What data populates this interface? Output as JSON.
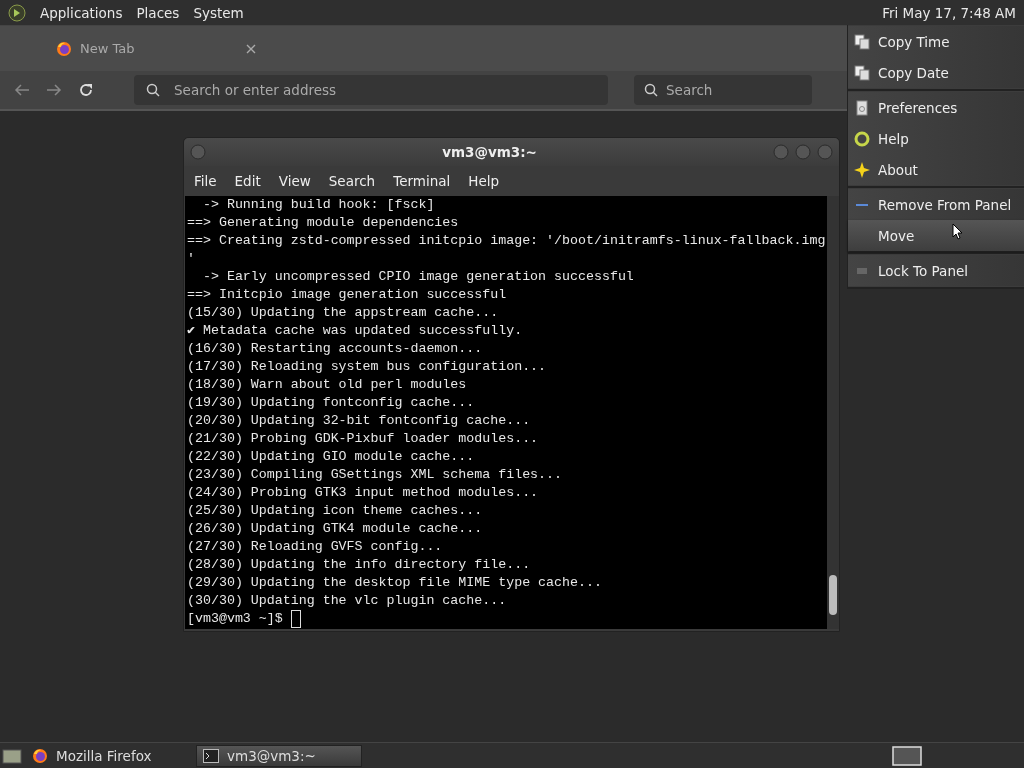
{
  "top_panel": {
    "menus": [
      "Applications",
      "Places",
      "System"
    ],
    "clock": "Fri May 17,  7:48 AM"
  },
  "browser": {
    "tab": {
      "title": "New Tab"
    },
    "address": {
      "placeholder": "Search or enter address"
    },
    "search": {
      "placeholder": "Search"
    }
  },
  "terminal": {
    "title": "vm3@vm3:~",
    "menu": [
      "File",
      "Edit",
      "View",
      "Search",
      "Terminal",
      "Help"
    ],
    "lines": [
      "  -> Running build hook: [fsck]",
      "==> Generating module dependencies",
      "==> Creating zstd-compressed initcpio image: '/boot/initramfs-linux-fallback.img",
      "'",
      "  -> Early uncompressed CPIO image generation successful",
      "==> Initcpio image generation successful",
      "(15/30) Updating the appstream cache...",
      "✔ Metadata cache was updated successfully.",
      "(16/30) Restarting accounts-daemon...",
      "(17/30) Reloading system bus configuration...",
      "(18/30) Warn about old perl modules",
      "(19/30) Updating fontconfig cache...",
      "(20/30) Updating 32-bit fontconfig cache...",
      "(21/30) Probing GDK-Pixbuf loader modules...",
      "(22/30) Updating GIO module cache...",
      "(23/30) Compiling GSettings XML schema files...",
      "(24/30) Probing GTK3 input method modules...",
      "(25/30) Updating icon theme caches...",
      "(26/30) Updating GTK4 module cache...",
      "(27/30) Reloading GVFS config...",
      "(28/30) Updating the info directory file...",
      "(29/30) Updating the desktop file MIME type cache...",
      "(30/30) Updating the vlc plugin cache..."
    ],
    "prompt": "[vm3@vm3 ~]$ "
  },
  "context_menu": {
    "groups": [
      [
        {
          "label": "Copy Time",
          "kind": "copy",
          "selected": false
        },
        {
          "label": "Copy Date",
          "kind": "copy",
          "selected": false
        }
      ],
      [
        {
          "label": "Preferences",
          "kind": "prefs",
          "selected": false
        },
        {
          "label": "Help",
          "kind": "help",
          "selected": false
        },
        {
          "label": "About",
          "kind": "about",
          "selected": false
        }
      ],
      [
        {
          "label": "Remove From Panel",
          "kind": "remove",
          "selected": false
        },
        {
          "label": "Move",
          "kind": "plain",
          "selected": true
        }
      ],
      [
        {
          "label": "Lock To Panel",
          "kind": "lock",
          "selected": false
        }
      ]
    ]
  },
  "taskbar": {
    "tasks": [
      {
        "label": "Mozilla Firefox",
        "kind": "browser",
        "selected": false
      },
      {
        "label": "vm3@vm3:~",
        "kind": "terminal",
        "selected": true
      }
    ]
  }
}
